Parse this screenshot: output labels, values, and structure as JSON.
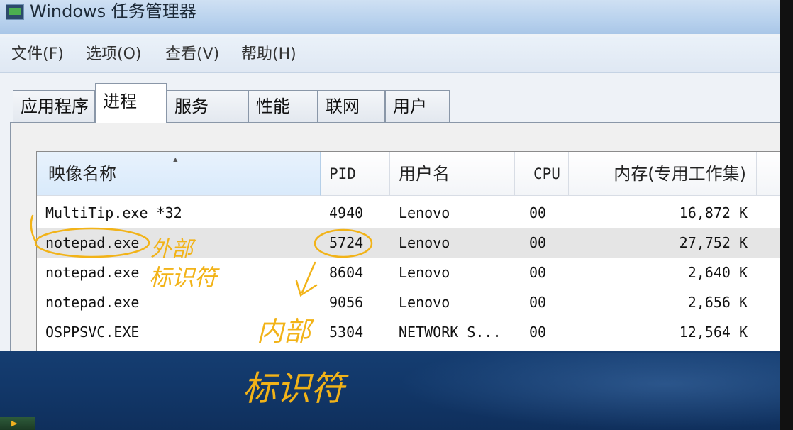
{
  "window": {
    "title": "Windows 任务管理器",
    "app_icon": "monitor-icon"
  },
  "menu": [
    "文件(F)",
    "选项(O)",
    "查看(V)",
    "帮助(H)"
  ],
  "tabs": [
    "应用程序",
    "进程",
    "服务",
    "性能",
    "联网",
    "用户"
  ],
  "active_tab": "进程",
  "columns": [
    "映像名称",
    "PID",
    "用户名",
    "CPU",
    "内存(专用工作集)"
  ],
  "sorted_column": "映像名称",
  "rows": [
    {
      "name": "MultiTip.exe *32",
      "pid": "4940",
      "user": "Lenovo",
      "cpu": "00",
      "mem": "16,872 K"
    },
    {
      "name": "notepad.exe",
      "pid": "5724",
      "user": "Lenovo",
      "cpu": "00",
      "mem": "27,752 K"
    },
    {
      "name": "notepad.exe",
      "pid": "8604",
      "user": "Lenovo",
      "cpu": "00",
      "mem": "2,640 K"
    },
    {
      "name": "notepad.exe",
      "pid": "9056",
      "user": "Lenovo",
      "cpu": "00",
      "mem": "2,656 K"
    },
    {
      "name": "OSPPSVC.EXE",
      "pid": "5304",
      "user": "NETWORK S...",
      "cpu": "00",
      "mem": "12,564 K"
    }
  ],
  "selected_row": 1,
  "annotations": {
    "external_line1": "外部",
    "external_line2": "标识符",
    "internal_line1": "内部",
    "internal_line2": "标识符",
    "ink_color": "#f2b318"
  }
}
